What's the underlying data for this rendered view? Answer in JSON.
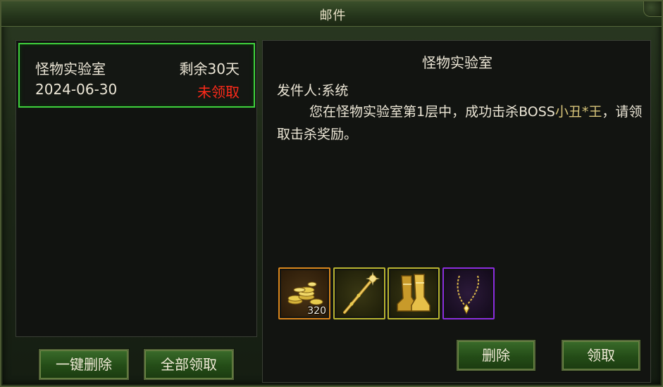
{
  "window": {
    "title": "邮件"
  },
  "mail_list": {
    "items": [
      {
        "subject": "怪物实验室",
        "remaining": "剩余30天",
        "date": "2024-06-30",
        "status": "未领取",
        "selected": true
      }
    ]
  },
  "mail_detail": {
    "title": "怪物实验室",
    "sender": "发件人:系统",
    "body_before": "您在怪物实验室第1层中，成功击杀BOSS",
    "body_highlight": "小丑*王",
    "body_after": "，请领取击杀奖励。",
    "attachments": [
      {
        "icon": "gold-coins-icon",
        "quantity": "320",
        "rarity_color": "#d9861c"
      },
      {
        "icon": "golden-staff-icon",
        "quantity": "",
        "rarity_color": "#b9b530"
      },
      {
        "icon": "golden-boots-icon",
        "quantity": "",
        "rarity_color": "#b9b530"
      },
      {
        "icon": "gold-necklace-icon",
        "quantity": "",
        "rarity_color": "#8b2de0"
      }
    ]
  },
  "buttons": {
    "delete_all": "一键删除",
    "claim_all": "全部领取",
    "delete": "删除",
    "claim": "领取"
  },
  "colors": {
    "selected_border": "#3fd13c",
    "unclaimed_status": "#ff2a1a",
    "highlight_text": "#d8c57a"
  }
}
